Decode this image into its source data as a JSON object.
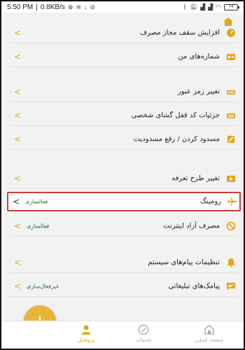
{
  "status_bar": {
    "time": "5:50 PM",
    "network_speed": "0.8KB/s",
    "battery": "74"
  },
  "accent_color": "#e0a81a",
  "highlight_color": "#d23b3b",
  "value_color": "#1e6b3b",
  "top_icon": "home-icon",
  "menu": [
    {
      "label": "افزایش سقف مجاز مصرف",
      "icon": "speedometer-icon"
    },
    {
      "label": "شماره‌های من",
      "icon": "sim-cards-icon"
    },
    {
      "label": "تغییر رمز عبور",
      "icon": "key-icon"
    },
    {
      "label": "جزئیات کد قفل گشای شخصی",
      "icon": "keypad-icon"
    },
    {
      "label": "مسدود کردن / رفع مسدودیت",
      "icon": "block-sim-icon"
    },
    {
      "label": "تغییر طرح تعرفه",
      "icon": "tariff-icon"
    },
    {
      "label": "رومینگ",
      "icon": "airplane-icon",
      "value": "فعالسازی"
    },
    {
      "label": "مصرف آزاد اینترنت",
      "icon": "no-limit-icon",
      "value": "فعالسازی"
    },
    {
      "label": "تنظیمات پیام‌های سیستم",
      "icon": "bell-icon"
    },
    {
      "label": "پیامک‌های تبلیغاتی",
      "icon": "message-icon",
      "value": "غیرفعال‌سازی"
    }
  ],
  "fab": {
    "label": "+"
  },
  "bottom_nav": [
    {
      "label": "صفحه اصلی",
      "icon": "home-icon"
    },
    {
      "label": "خدمات",
      "icon": "services-icon"
    },
    {
      "label": "پروفایل",
      "icon": "profile-icon"
    }
  ]
}
